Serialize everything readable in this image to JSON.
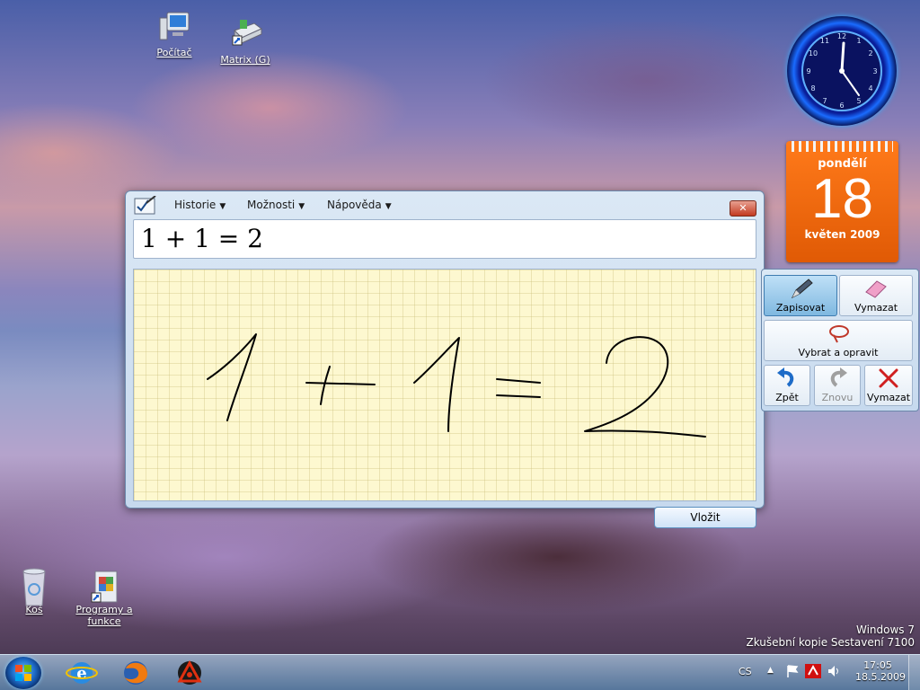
{
  "desktop": {
    "icons": [
      {
        "label": "Počítač"
      },
      {
        "label": "Matrix (G)"
      },
      {
        "label": "Koš"
      },
      {
        "label": "Programy a funkce"
      }
    ],
    "watermark": {
      "line1": "Windows 7",
      "line2": "Zkušební kopie Sestavení 7100"
    }
  },
  "gadgets": {
    "clock": {
      "time_shown": "17:05"
    },
    "calendar": {
      "weekday": "pondělí",
      "day": "18",
      "month_year": "květen 2009"
    }
  },
  "tip": {
    "menu": [
      {
        "label": "Historie"
      },
      {
        "label": "Možnosti"
      },
      {
        "label": "Nápověda"
      }
    ],
    "close_label": "✕",
    "preview": "1 + 1 = 2",
    "insert_label": "Vložit",
    "tools": {
      "write": "Zapisovat",
      "erase": "Vymazat",
      "select_correct": "Vybrat a opravit",
      "undo": "Zpět",
      "redo": "Znovu",
      "clear": "Vymazat"
    },
    "colors": {
      "ink_bg": "#fdf8d0",
      "window": "#c6d9ee",
      "active_tool": "#7fb8e0"
    }
  },
  "taskbar": {
    "language": "CS",
    "time": "17:05",
    "date": "18.5.2009",
    "apps": [
      "internet-explorer-icon",
      "firefox-icon",
      "reason-icon"
    ]
  }
}
